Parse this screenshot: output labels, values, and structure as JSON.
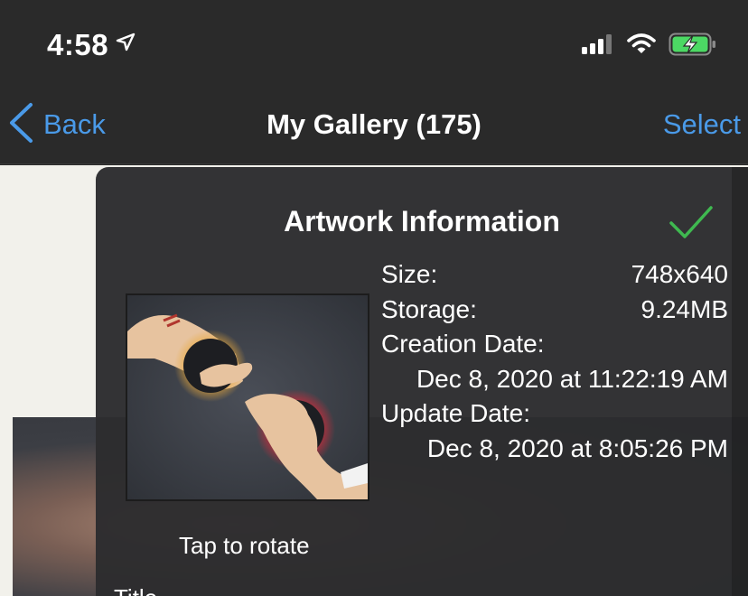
{
  "status_bar": {
    "time": "4:58",
    "icons": [
      "location-arrow-icon",
      "cellular-signal-icon",
      "wifi-icon",
      "battery-charging-icon"
    ],
    "battery_color": "#4cd964"
  },
  "nav_bar": {
    "back_label": "Back",
    "title": "My Gallery (175)",
    "select_label": "Select",
    "accent_color": "#4a9ae8"
  },
  "artwork_info": {
    "title": "Artwork Information",
    "check_color": "#3fb950",
    "size_label": "Size:",
    "size_value": "748x640",
    "storage_label": "Storage:",
    "storage_value": "9.24MB",
    "creation_label": "Creation Date:",
    "creation_value": "Dec 8, 2020 at 11:22:19 AM",
    "update_label": "Update Date:",
    "update_value": "Dec 8, 2020 at 8:05:26 PM",
    "rotate_hint": "Tap to rotate",
    "title_field_label": "Title"
  }
}
